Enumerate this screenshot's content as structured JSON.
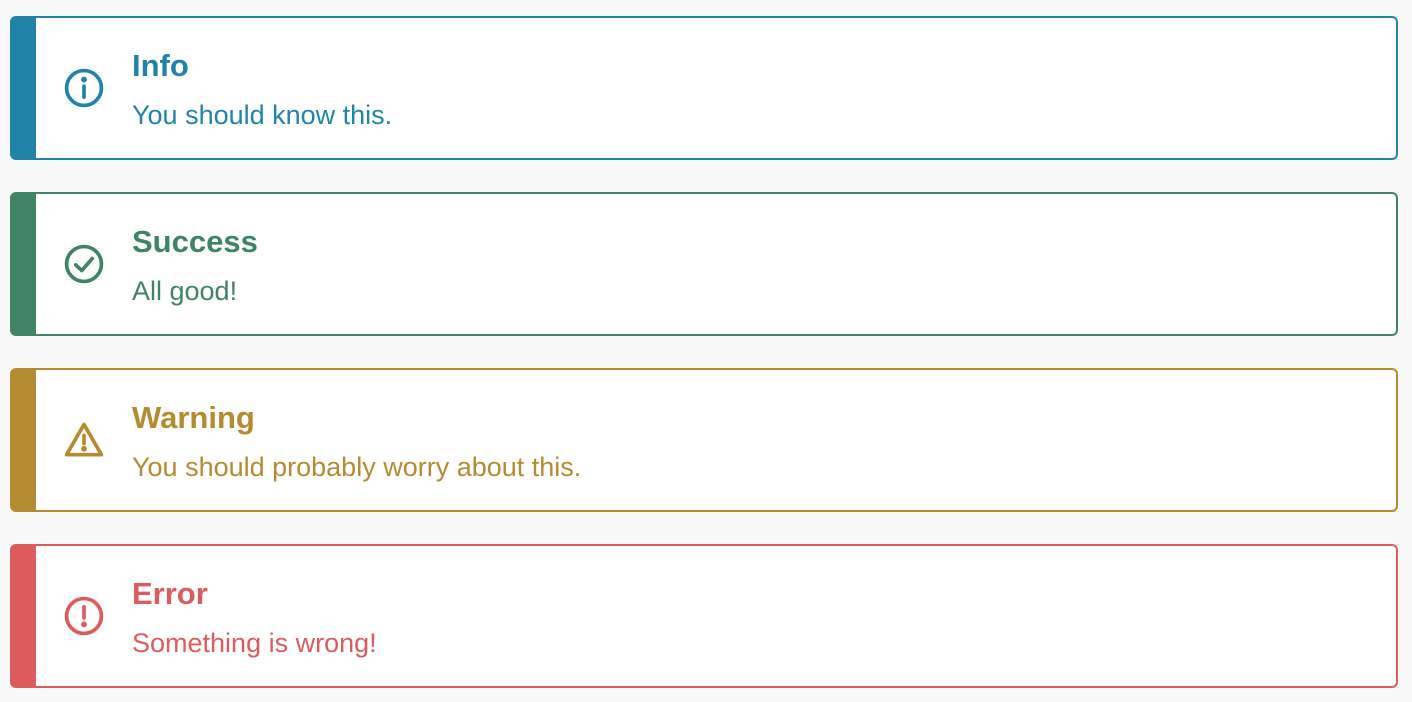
{
  "alerts": [
    {
      "variant": "info",
      "title": "Info",
      "message": "You should know this.",
      "color": "#1f84a8",
      "icon": "info-icon"
    },
    {
      "variant": "success",
      "title": "Success",
      "message": "All good!",
      "color": "#3e8465",
      "icon": "check-circle-icon"
    },
    {
      "variant": "warning",
      "title": "Warning",
      "message": "You should probably worry about this.",
      "color": "#b58b32",
      "icon": "warning-triangle-icon"
    },
    {
      "variant": "error",
      "title": "Error",
      "message": "Something is wrong!",
      "color": "#dc5b5c",
      "icon": "error-circle-icon"
    }
  ]
}
